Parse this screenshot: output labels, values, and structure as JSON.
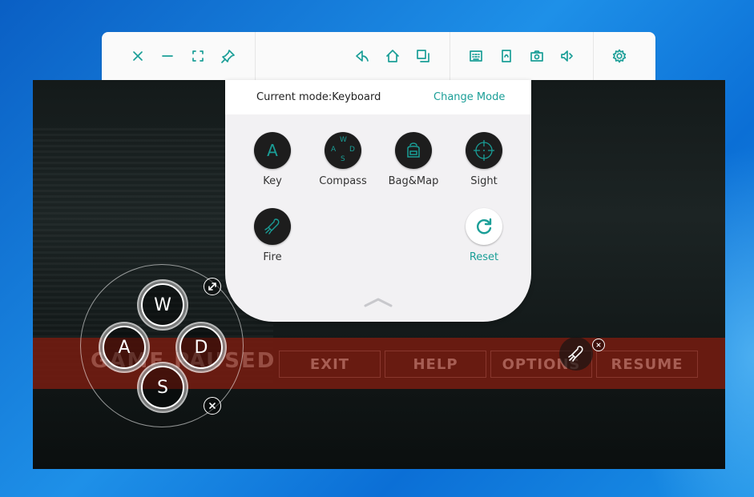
{
  "panel": {
    "current_mode_label": "Current mode:Keyboard",
    "change_mode": "Change Mode",
    "items": [
      {
        "label": "Key",
        "glyph": "A"
      },
      {
        "label": "Compass",
        "glyph": "W A D S"
      },
      {
        "label": "Bag&Map"
      },
      {
        "label": "Sight"
      },
      {
        "label": "Fire"
      },
      {
        "label": "Reset"
      }
    ]
  },
  "game": {
    "pause_title": "GAME PAUSED",
    "buttons": [
      "EXIT",
      "HELP",
      "OPTIONS",
      "RESUME"
    ]
  },
  "joystick": {
    "up": "W",
    "left": "A",
    "right": "D",
    "down": "S"
  },
  "compass_letters": {
    "n": "W",
    "w": "A",
    "e": "D",
    "s": "S"
  },
  "colors": {
    "accent": "#1a9e97",
    "panel_bg": "#f2f1f3",
    "pause_bar": "#781c10"
  },
  "toolbar_icons": [
    "close-icon",
    "minimize-icon",
    "fullscreen-icon",
    "pin-icon",
    "back-icon",
    "home-icon",
    "recent-apps-icon",
    "keyboard-icon",
    "shake-icon",
    "screenshot-icon",
    "volume-icon",
    "settings-icon"
  ]
}
